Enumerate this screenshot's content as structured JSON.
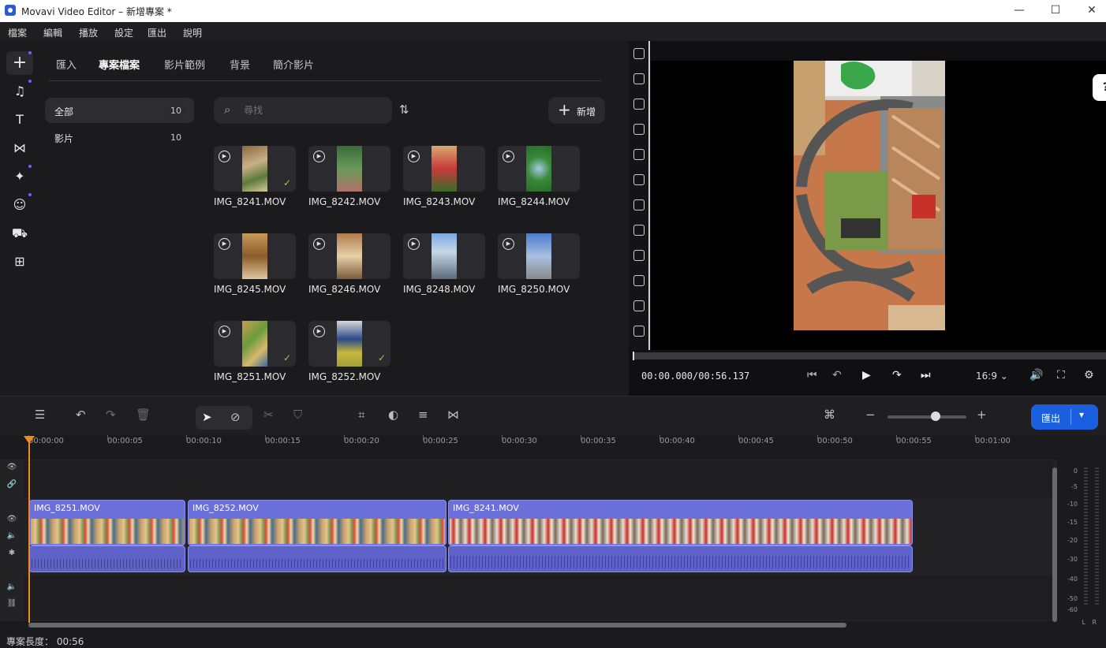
{
  "window": {
    "title": "Movavi Video Editor – 新增專案 *",
    "minimize": "—",
    "maximize": "☐",
    "close": "✕"
  },
  "menu": [
    "檔案",
    "編輯",
    "播放",
    "設定",
    "匯出",
    "說明"
  ],
  "left_tools": [
    {
      "icon": "plus-icon",
      "glyph": "+"
    },
    {
      "icon": "music-icon",
      "glyph": "♫"
    },
    {
      "icon": "text-icon",
      "glyph": "T"
    },
    {
      "icon": "transitions-icon",
      "glyph": "⋈"
    },
    {
      "icon": "magic-wand-icon",
      "glyph": "✦"
    },
    {
      "icon": "stickers-icon",
      "glyph": "☺"
    },
    {
      "icon": "media-bag-icon",
      "glyph": "⛟"
    },
    {
      "icon": "more-tools-icon",
      "glyph": "⊞"
    }
  ],
  "media": {
    "tabs": [
      "匯入",
      "專案檔案",
      "影片範例",
      "背景",
      "簡介影片"
    ],
    "active_tab": 1,
    "categories": [
      {
        "label": "全部",
        "count": "10"
      },
      {
        "label": "影片",
        "count": "10"
      }
    ],
    "search_placeholder": "尋找",
    "add_label": "新增",
    "clips": [
      {
        "name": "IMG_8241.MOV",
        "used": true
      },
      {
        "name": "IMG_8242.MOV",
        "used": false
      },
      {
        "name": "IMG_8243.MOV",
        "used": false
      },
      {
        "name": "IMG_8244.MOV",
        "used": false
      },
      {
        "name": "IMG_8245.MOV",
        "used": false
      },
      {
        "name": "IMG_8246.MOV",
        "used": false
      },
      {
        "name": "IMG_8248.MOV",
        "used": false
      },
      {
        "name": "IMG_8250.MOV",
        "used": false
      },
      {
        "name": "IMG_8251.MOV",
        "used": true
      },
      {
        "name": "IMG_8252.MOV",
        "used": true
      }
    ]
  },
  "preview": {
    "help": "?",
    "timecode": "00:00.000/00:56.137",
    "aspect": "16:9",
    "aspect_chevron": "⌄"
  },
  "timeline": {
    "export_label": "匯出",
    "ruler": [
      "00:00:00",
      "00:00:05",
      "00:00:10",
      "00:00:15",
      "00:00:20",
      "00:00:25",
      "00:00:30",
      "00:00:35",
      "00:00:40",
      "00:00:45",
      "00:00:50",
      "00:00:55",
      "00:01:00"
    ],
    "video_clips": [
      "IMG_8251.MOV",
      "IMG_8252.MOV",
      "IMG_8241.MOV"
    ],
    "meter_labels": [
      "0",
      "-5",
      "-10",
      "-15",
      "-20",
      "-30",
      "-40",
      "-50",
      "-60"
    ],
    "meter_channels": [
      "L",
      "R"
    ]
  },
  "status": {
    "project_length": "專案長度： 00:56"
  },
  "colors": {
    "accent": "#1a5fe0",
    "playhead": "#f08a24",
    "clip": "#6b6fd9",
    "check": "#9acd32"
  }
}
